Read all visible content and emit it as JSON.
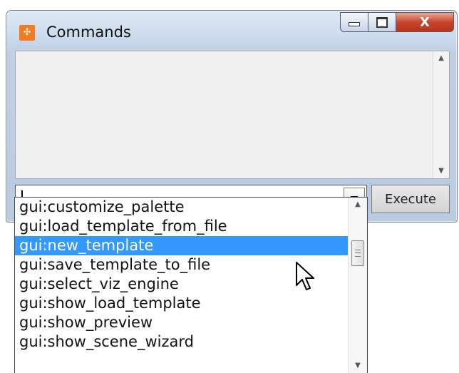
{
  "window": {
    "title": "Commands",
    "app_icon": "app-icon-orange",
    "controls": {
      "minimize_icon": "minimize-icon",
      "maximize_icon": "maximize-icon",
      "close_label": "X"
    }
  },
  "command_input": {
    "value": "",
    "dropdown_icon": "chevron-down-icon"
  },
  "execute_button": {
    "label": "Execute"
  },
  "dropdown": {
    "items": [
      "gui:customize_palette",
      "gui:load_template_from_file",
      "gui:new_template",
      "gui:save_template_to_file",
      "gui:select_viz_engine",
      "gui:show_load_template",
      "gui:show_preview",
      "gui:show_scene_wizard"
    ],
    "selected_index": 2
  },
  "colors": {
    "selection": "#3399ff",
    "app_icon": "#f47a1f",
    "close_button": "#c7452c"
  }
}
